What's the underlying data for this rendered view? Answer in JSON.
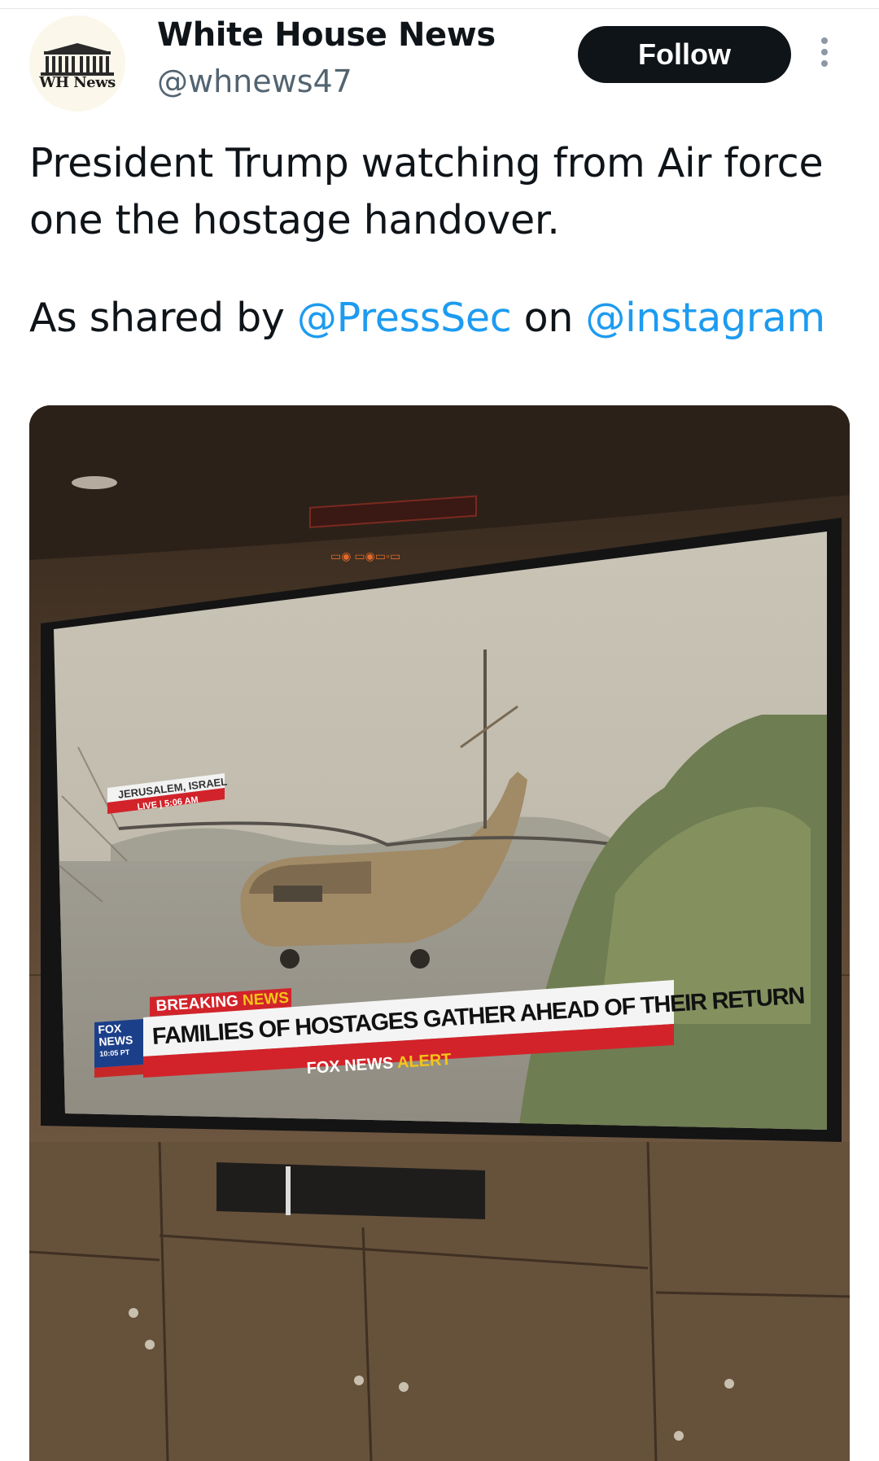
{
  "account": {
    "display_name": "White House News",
    "handle": "@whnews47",
    "avatar_text": "WH News",
    "follow_label": "Follow",
    "more_icon": "more-vertical-icon"
  },
  "tweet": {
    "line1": "President Trump watching from Air force one the hostage handover.",
    "shared_prefix": "As shared by ",
    "mention1": "@PressSec",
    "shared_middle": " on ",
    "mention2": "@instagram"
  },
  "tv_screen": {
    "location": "JERUSALEM, ISRAEL",
    "live_text": "LIVE | 5:06 AM",
    "breaking_label_1": "BREAKING",
    "breaking_label_2": "NEWS",
    "network_line1": "FOX",
    "network_line2": "NEWS",
    "network_time": "10:05 PT",
    "headline": "FAMILIES OF HOSTAGES GATHER AHEAD OF THEIR RETURN",
    "alert_part1": "FOX NEWS",
    "alert_part2": "ALERT"
  },
  "colors": {
    "follow_bg": "#0f1419",
    "mention": "#1d9bf0",
    "breaking_red": "#d2232a",
    "news_yellow": "#f5c518"
  }
}
